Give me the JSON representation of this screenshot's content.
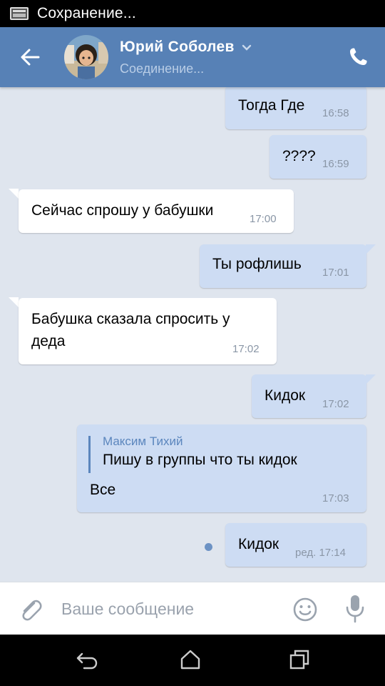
{
  "status_bar": {
    "text": "Сохранение...",
    "icon": "image-icon"
  },
  "header": {
    "title": "Юрий Соболев",
    "subtitle": "Соединение...",
    "accent": "#5781b6",
    "back_icon": "arrow-left-icon",
    "call_icon": "phone-icon",
    "chevron_icon": "chevron-down-icon"
  },
  "messages": [
    {
      "dir": "out",
      "text": "Тогда Где",
      "time": "16:58"
    },
    {
      "dir": "out",
      "text": "????",
      "time": "16:59"
    },
    {
      "dir": "in",
      "text": "Сейчас спрошу у бабушки",
      "time": "17:00"
    },
    {
      "dir": "out",
      "text": "Ты рофлишь",
      "time": "17:01"
    },
    {
      "dir": "in",
      "text_line1": "Бабушка сказала спросить у",
      "text_line2": "деда",
      "time": "17:02"
    },
    {
      "dir": "out",
      "text": "Кидок",
      "time": "17:02"
    },
    {
      "dir": "out",
      "quote_author": "Максим Тихий",
      "quote_text": "Пишу в группы что ты кидок",
      "text": "Все",
      "time": "17:03"
    },
    {
      "dir": "out",
      "text": "Кидок",
      "time": "ред. 17:14",
      "unread": true
    }
  ],
  "composer": {
    "placeholder": "Ваше сообщение",
    "attach_icon": "paperclip-icon",
    "emoji_icon": "smiley-icon",
    "mic_icon": "microphone-icon"
  },
  "nav_bar": {
    "back_icon": "nav-back-icon",
    "home_icon": "nav-home-icon",
    "recent_icon": "nav-recent-icon"
  }
}
